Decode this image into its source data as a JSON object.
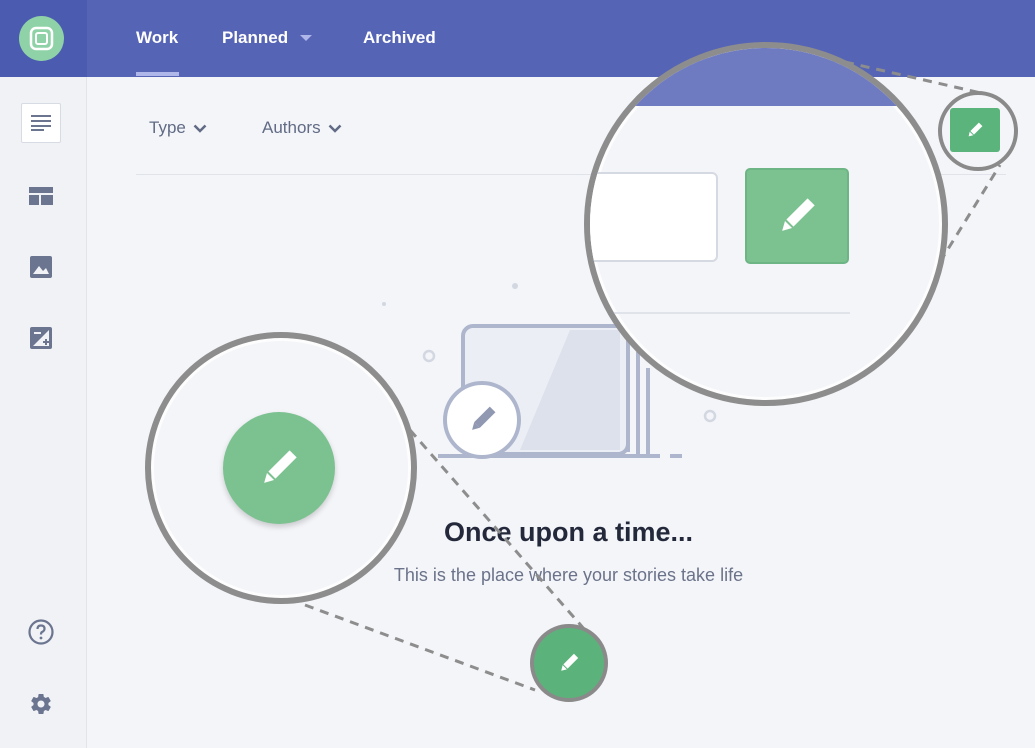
{
  "nav": {
    "tabs": [
      {
        "label": "Work",
        "active": true
      },
      {
        "label": "Planned",
        "has_dropdown": true
      },
      {
        "label": "Archived"
      }
    ]
  },
  "sidebar": {
    "items": [
      {
        "icon": "stories-list-icon",
        "active": true
      },
      {
        "icon": "layout-icon"
      },
      {
        "icon": "image-icon"
      },
      {
        "icon": "add-image-icon"
      }
    ],
    "bottom_items": [
      {
        "icon": "help-icon"
      },
      {
        "icon": "settings-gear-icon"
      }
    ]
  },
  "filters": {
    "type_label": "Type",
    "authors_label": "Authors"
  },
  "empty_state": {
    "title": "Once upon a time...",
    "subtitle": "This is the place where your stories take life"
  },
  "colors": {
    "topbar": "#5664b6",
    "accent_green": "#5cb27b",
    "logo_green": "#8fd2a7",
    "zoom_ring": "#8d8d8d"
  }
}
